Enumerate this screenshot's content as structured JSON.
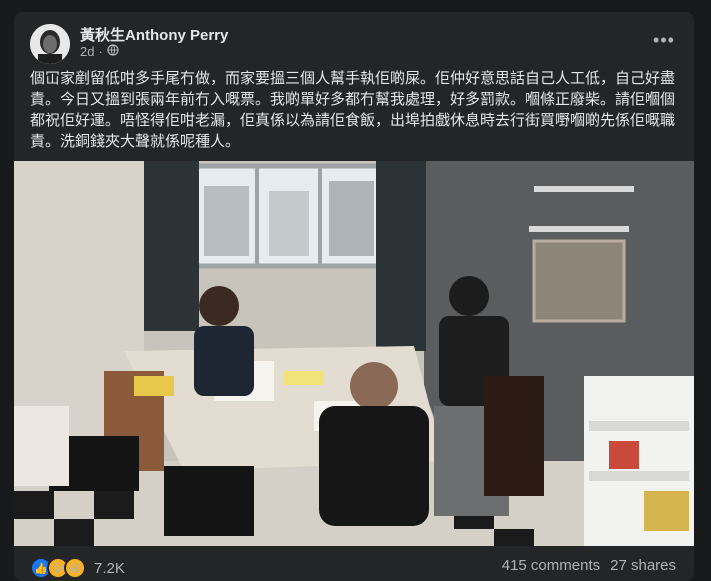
{
  "post": {
    "author": "黃秋生Anthony Perry",
    "time": "2d",
    "audience_icon": "globe-icon",
    "text": "個冚家剷留低咁多手尾冇做，而家要搵三個人幫手執佢啲屎。佢仲好意思話自己人工低，自己好盡責。今日又搵到張兩年前冇入嘅票。我啲單好多都冇幫我處理，好多罰款。嗰條正廢柴。請佢嗰個都祝佢好運。唔怪得佢咁老漏，佢真係以為請佢食飯，出埠拍戲休息時去行街買嘢嗰啲先係佢嘅職責。洗銅錢夾大聲就係呢種人。"
  },
  "reactions": {
    "icons": [
      "like-icon",
      "wow-icon",
      "haha-icon"
    ],
    "count": "7.2K"
  },
  "stats": {
    "comments": "415 comments",
    "shares": "27 shares"
  },
  "colors": {
    "background": "#18191a",
    "card": "#242526",
    "text": "#e4e6eb",
    "secondary": "#b0b3b8",
    "like": "#1877f2",
    "wow": "#f7b125"
  }
}
